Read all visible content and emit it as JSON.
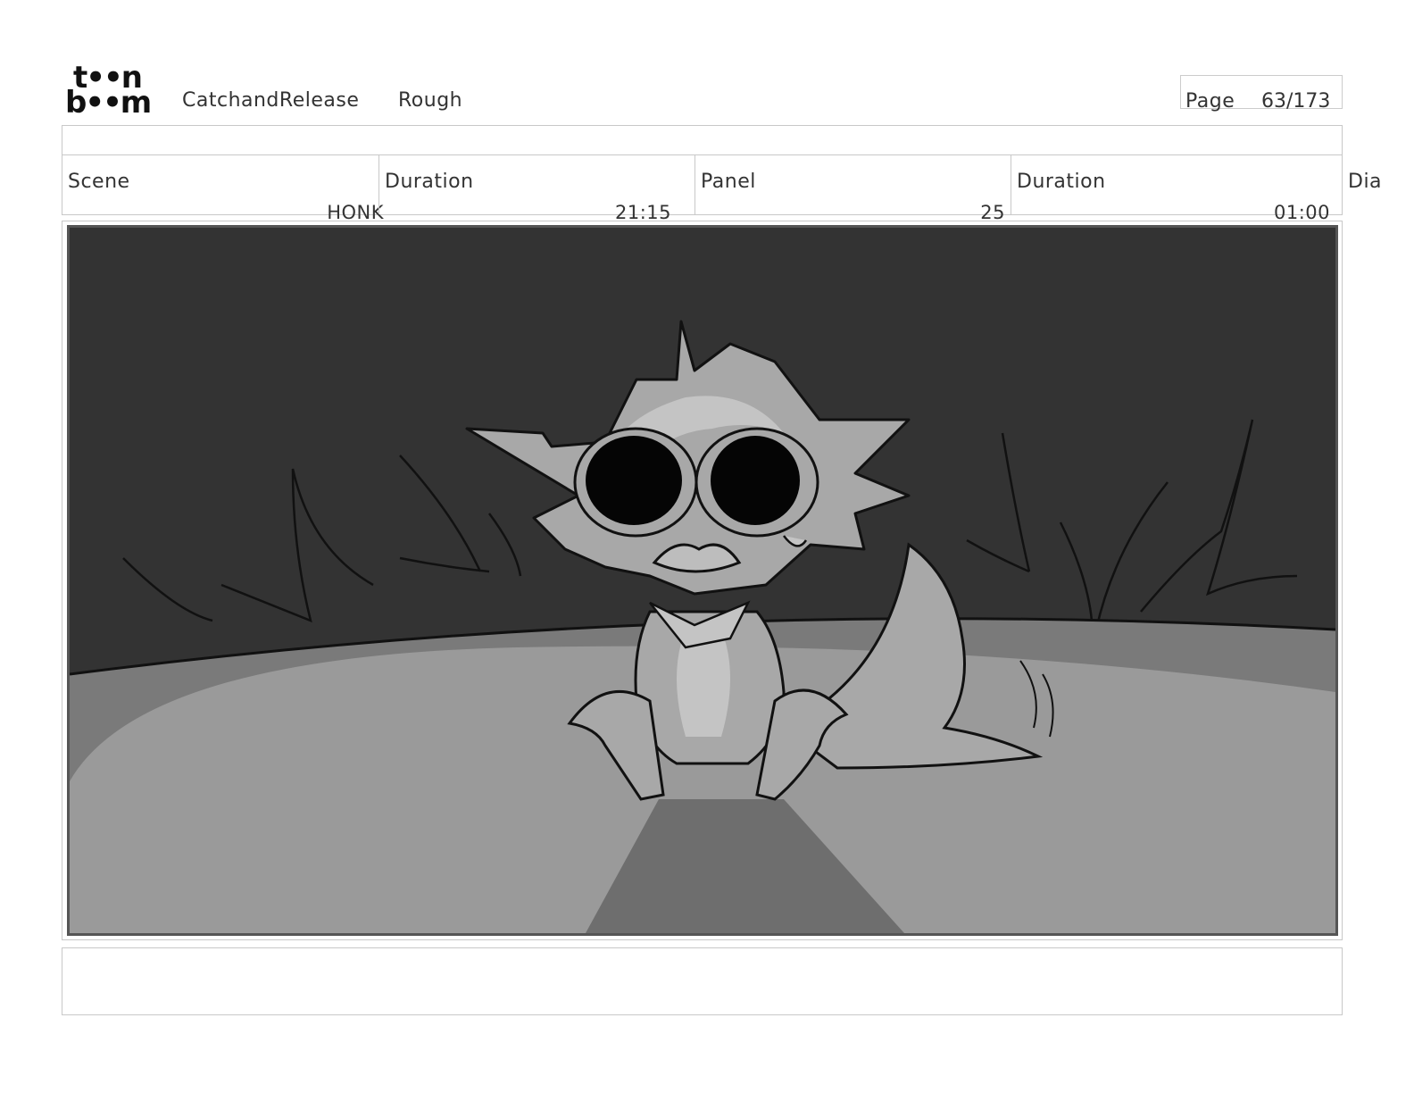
{
  "header": {
    "logo_top": "t••n",
    "logo_bottom": "b••m",
    "project_title": "CatchandRelease",
    "stage": "Rough",
    "page_label": "Page",
    "page_number": "63/173"
  },
  "meta": {
    "scene_label": "Scene",
    "scene_value": "HONK",
    "scene_duration_label": "Duration",
    "scene_duration_value": "21:15",
    "panel_label": "Panel",
    "panel_value": "25",
    "panel_duration_label": "Duration",
    "panel_duration_value": "01:00",
    "dialogue_label": "Dia"
  },
  "panel": {
    "colors": {
      "sky": "#333333",
      "ground_far": "#7a7a7a",
      "ground": "#9a9a9a",
      "light_beam": "#6e6e6e",
      "character": "#a8a8a8",
      "character_light": "#c4c4c4",
      "outline": "#111111"
    }
  },
  "caption": {
    "text": ""
  }
}
